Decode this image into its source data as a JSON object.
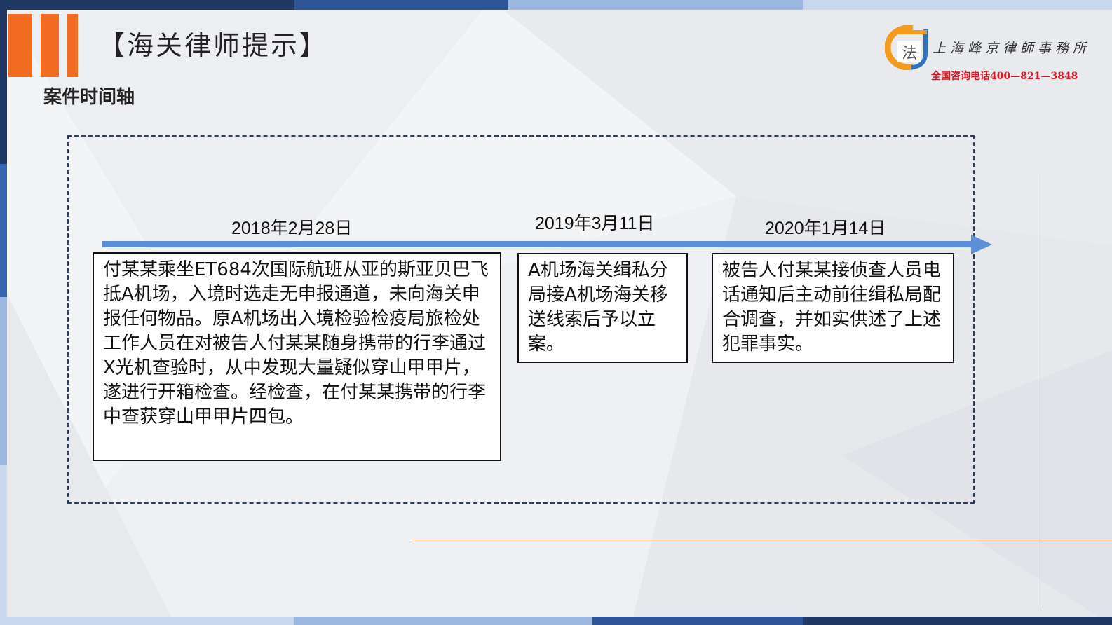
{
  "header": {
    "title": "【海关律师提示】",
    "subtitle": "案件时间轴"
  },
  "firm": {
    "name": "上海峰京律師事務所",
    "phone": "全国咨询电话400—821—3848"
  },
  "timeline": [
    {
      "date": "2018年2月28日",
      "text": "付某某乘坐ET684次国际航班从亚的斯亚贝巴飞抵A机场，入境时选走无申报通道，未向海关申报任何物品。原A机场出入境检验检疫局旅检处工作人员在对被告人付某某随身携带的行李通过X光机查验时，从中发现大量疑似穿山甲甲片，遂进行开箱检查。经检查，在付某某携带的行李中查获穿山甲甲片四包。"
    },
    {
      "date": "2019年3月11日",
      "text": "A机场海关缉私分局接A机场海关移送线索后予以立案。"
    },
    {
      "date": "2020年1月14日",
      "text": "被告人付某某接侦查人员电话通知后主动前往缉私局配合调查，并如实供述了上述犯罪事实。"
    }
  ],
  "colors": {
    "accent_orange": "#f26d21",
    "arrow_blue": "#5b8fd6",
    "phone_red": "#e0141e",
    "frame_navy": "#2e3e66"
  }
}
